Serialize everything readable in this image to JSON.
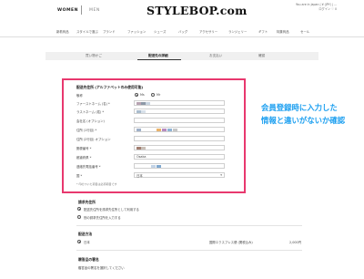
{
  "header": {
    "women": "WOMEN",
    "men": "MEN",
    "logo": "STYLEBOP.com",
    "top_right_line1": "You are in Japan | ¥ (JPY) | ...",
    "top_right_line2": "ログイン ♡ 0"
  },
  "nav": {
    "items": [
      "新着商品",
      "スタイルで選ぶ",
      "ブランド",
      "ファッション",
      "シューズ",
      "バッグ",
      "アクセサリー",
      "ランジェリー",
      "ギフト",
      "特集商品",
      "セール"
    ]
  },
  "steps": {
    "items": [
      "買い物かご",
      "配送先の詳細",
      "お支払い",
      "確認"
    ]
  },
  "form": {
    "title": "配送先住所 (アルファベットのみ使用可能)",
    "labels": {
      "gender": "敬称",
      "firstname": "ファーストネーム (名) *",
      "lastname": "ラストネーム (姓) *",
      "company": "会社名 (オプション)",
      "address": "住所 (1行目) *",
      "address2": "住所 (2行目) オプション",
      "zip": "郵便番号 *",
      "city": "都道府県 *",
      "phone": "連絡先電話番号 *",
      "country": "国 *"
    },
    "gender_options": [
      "Ms",
      "Mr"
    ],
    "gender_selected": "Ms",
    "city_value": "Osaka",
    "country_value": "日本",
    "note": "* 印のついた項目は必須項目です"
  },
  "annotation": {
    "line1": "会員登録時に入力した",
    "line2": "情報と違いがないか確認"
  },
  "billing": {
    "title": "請求先住所",
    "option1": "配送先住所を請求先住所として利用する",
    "option2": "別の請求先住所を入力する"
  },
  "shipping": {
    "title": "配送方法",
    "option": "日本",
    "carrier": "国際エクスプレス便 (関税込み)",
    "price": "2,000円"
  },
  "gift": {
    "title": "贈答品の署名",
    "text": "贈答品の署名を選択してください"
  }
}
